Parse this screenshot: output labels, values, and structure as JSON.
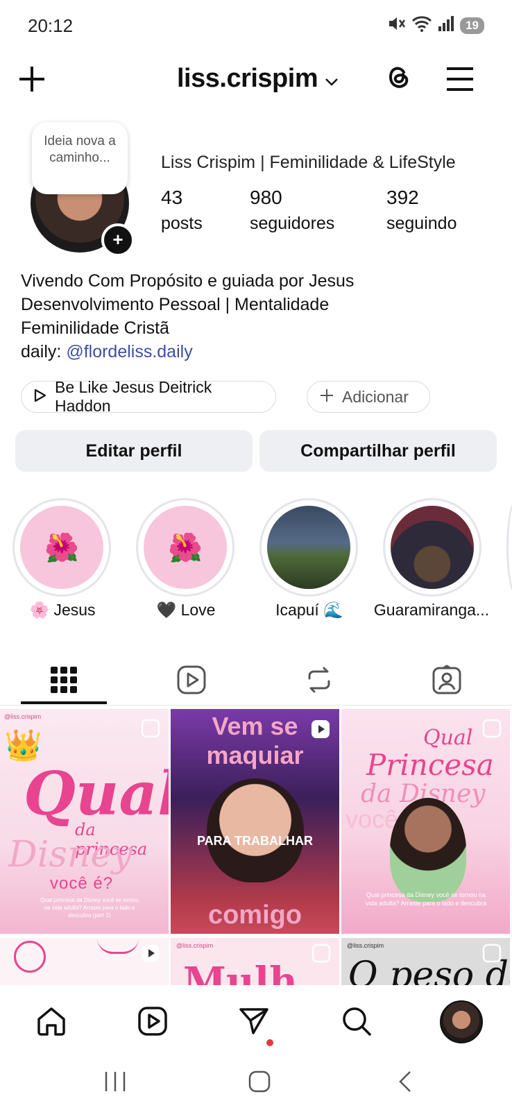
{
  "status": {
    "time": "20:12",
    "battery": "19"
  },
  "header": {
    "username": "liss.crispim"
  },
  "note": {
    "text": "Ideia nova a caminho..."
  },
  "profile": {
    "display_name": "Liss Crispim | Feminilidade & LifeStyle",
    "stats": [
      {
        "value": "43",
        "label": "posts"
      },
      {
        "value": "980",
        "label": "seguidores"
      },
      {
        "value": "392",
        "label": "seguindo"
      }
    ],
    "bio_lines": [
      "Vivendo Com Propósito e guiada por Jesus",
      "Desenvolvimento Pessoal | Mentalidade",
      "Feminilidade Cristã"
    ],
    "daily_prefix": "daily: ",
    "daily_link": "@flordeliss.daily"
  },
  "chips": {
    "music": "Be Like Jesus Deitrick Haddon",
    "add": "Adicionar"
  },
  "buttons": {
    "edit": "Editar perfil",
    "share": "Compartilhar perfil"
  },
  "highlights": [
    {
      "label": "🌸 Jesus"
    },
    {
      "label": "🖤 Love"
    },
    {
      "label": "Icapuí 🌊"
    },
    {
      "label": "Guaramiranga..."
    }
  ],
  "posts": [
    {
      "handle": "@liss.crispim",
      "big": "Qual",
      "mid": "da princesa",
      "script": "Disney",
      "sub": "você é?",
      "caption": "Qual princesa da Disney você se tornou na vida adulta? Arraste para o lado e descubra (part 2)"
    },
    {
      "top1": "Vem se",
      "top2": "maquiar",
      "middle": "PARA TRABALHAR",
      "bottom": "comigo"
    },
    {
      "top": "Qual",
      "big": "Princesa",
      "mid": "da Disney",
      "sub": "você é?",
      "caption": "Qual princesa da Disney você se tornou na vida adulta? Arraste para o lado e descubra"
    }
  ],
  "posts_row2": [
    {
      "text": ""
    },
    {
      "handle": "@liss.crispim",
      "text": "Mulh"
    },
    {
      "handle": "@liss.crispim",
      "text": "O peso da"
    }
  ],
  "colors": {
    "pink": "#e8448f",
    "link": "#3b4ea8",
    "button_bg": "#eeeff2",
    "notif": "#e5383b"
  }
}
